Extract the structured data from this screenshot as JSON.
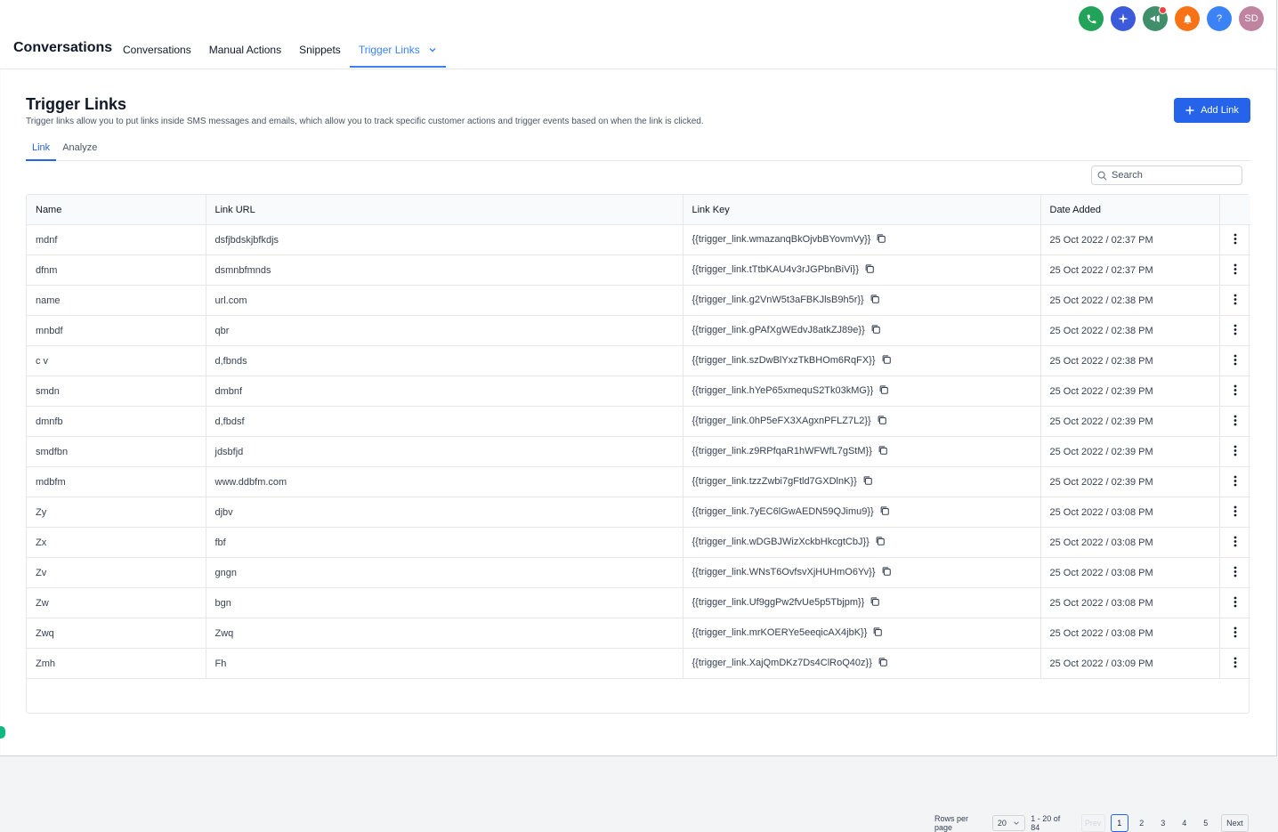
{
  "header": {
    "brand": "Conversations",
    "nav": [
      "Conversations",
      "Manual Actions",
      "Snippets",
      "Trigger Links"
    ],
    "avatar_initials": "SD",
    "help_label": "?"
  },
  "page": {
    "title": "Trigger Links",
    "subtitle": "Trigger links allow you to put links inside SMS messages and emails, which allow you to track specific customer actions and trigger events based on when the link is clicked.",
    "add_button": "Add Link",
    "tabs": [
      "Link",
      "Analyze"
    ],
    "search_placeholder": "Search"
  },
  "table": {
    "columns": [
      "Name",
      "Link URL",
      "Link Key",
      "Date Added"
    ],
    "rows": [
      {
        "name": "mdnf",
        "url": "dsfjbdskjbfkdjs",
        "key": "{{trigger_link.wmazanqBkOjvbBYovmVy}}",
        "date": "25 Oct 2022 / 02:37 PM"
      },
      {
        "name": "dfnm",
        "url": "dsmnbfmnds",
        "key": "{{trigger_link.tTtbKAU4v3rJGPbnBiVi}}",
        "date": "25 Oct 2022 / 02:37 PM"
      },
      {
        "name": "name",
        "url": "url.com",
        "key": "{{trigger_link.g2VnW5t3aFBKJlsB9h5r}}",
        "date": "25 Oct 2022 / 02:38 PM"
      },
      {
        "name": "mnbdf",
        "url": "qbr",
        "key": "{{trigger_link.gPAfXgWEdvJ8atkZJ89e}}",
        "date": "25 Oct 2022 / 02:38 PM"
      },
      {
        "name": "c v",
        "url": "d,fbnds",
        "key": "{{trigger_link.szDwBlYxzTkBHOm6RqFX}}",
        "date": "25 Oct 2022 / 02:38 PM"
      },
      {
        "name": "smdn",
        "url": "dmbnf",
        "key": "{{trigger_link.hYeP65xmequS2Tk03kMG}}",
        "date": "25 Oct 2022 / 02:39 PM"
      },
      {
        "name": "dmnfb",
        "url": "d,fbdsf",
        "key": "{{trigger_link.0hP5eFX3XAgxnPFLZ7L2}}",
        "date": "25 Oct 2022 / 02:39 PM"
      },
      {
        "name": "smdfbn",
        "url": "jdsbfjd",
        "key": "{{trigger_link.z9RPfqaR1hWFWfL7gStM}}",
        "date": "25 Oct 2022 / 02:39 PM"
      },
      {
        "name": "mdbfm",
        "url": "www.ddbfm.com",
        "key": "{{trigger_link.tzzZwbi7gFtld7GXDlnK}}",
        "date": "25 Oct 2022 / 02:39 PM"
      },
      {
        "name": "Zy",
        "url": "djbv",
        "key": "{{trigger_link.7yEC6lGwAEDN59QJimu9}}",
        "date": "25 Oct 2022 / 03:08 PM"
      },
      {
        "name": "Zx",
        "url": "fbf",
        "key": "{{trigger_link.wDGBJWizXckbHkcgtCbJ}}",
        "date": "25 Oct 2022 / 03:08 PM"
      },
      {
        "name": "Zv",
        "url": "gngn",
        "key": "{{trigger_link.WNsT6OvfsvXjHUHmO6Yv}}",
        "date": "25 Oct 2022 / 03:08 PM"
      },
      {
        "name": "Zw",
        "url": "bgn",
        "key": "{{trigger_link.Uf9ggPw2fvUe5p5Tbjpm}}",
        "date": "25 Oct 2022 / 03:08 PM"
      },
      {
        "name": "Zwq",
        "url": "Zwq",
        "key": "{{trigger_link.mrKOERYe5eeqicAX4jbK}}",
        "date": "25 Oct 2022 / 03:08 PM"
      },
      {
        "name": "Zmh",
        "url": "Fh",
        "key": "{{trigger_link.XajQmDKz7Ds4ClRoQ40z}}",
        "date": "25 Oct 2022 / 03:09 PM"
      }
    ]
  },
  "pagination": {
    "rows_per_page_label": "Rows per page",
    "rows_per_page": "20",
    "range": "1 - 20 of 84",
    "prev": "Prev",
    "pages": [
      "1",
      "2",
      "3",
      "4",
      "5"
    ],
    "next": "Next"
  },
  "colors": {
    "accent": "#2563eb",
    "phone": "#22a35a",
    "sparkle": "#3b5bdb",
    "megaphone": "#3f8f6b",
    "bell": "#f97316",
    "help": "#3b82f6",
    "avatar": "#c084a0"
  }
}
